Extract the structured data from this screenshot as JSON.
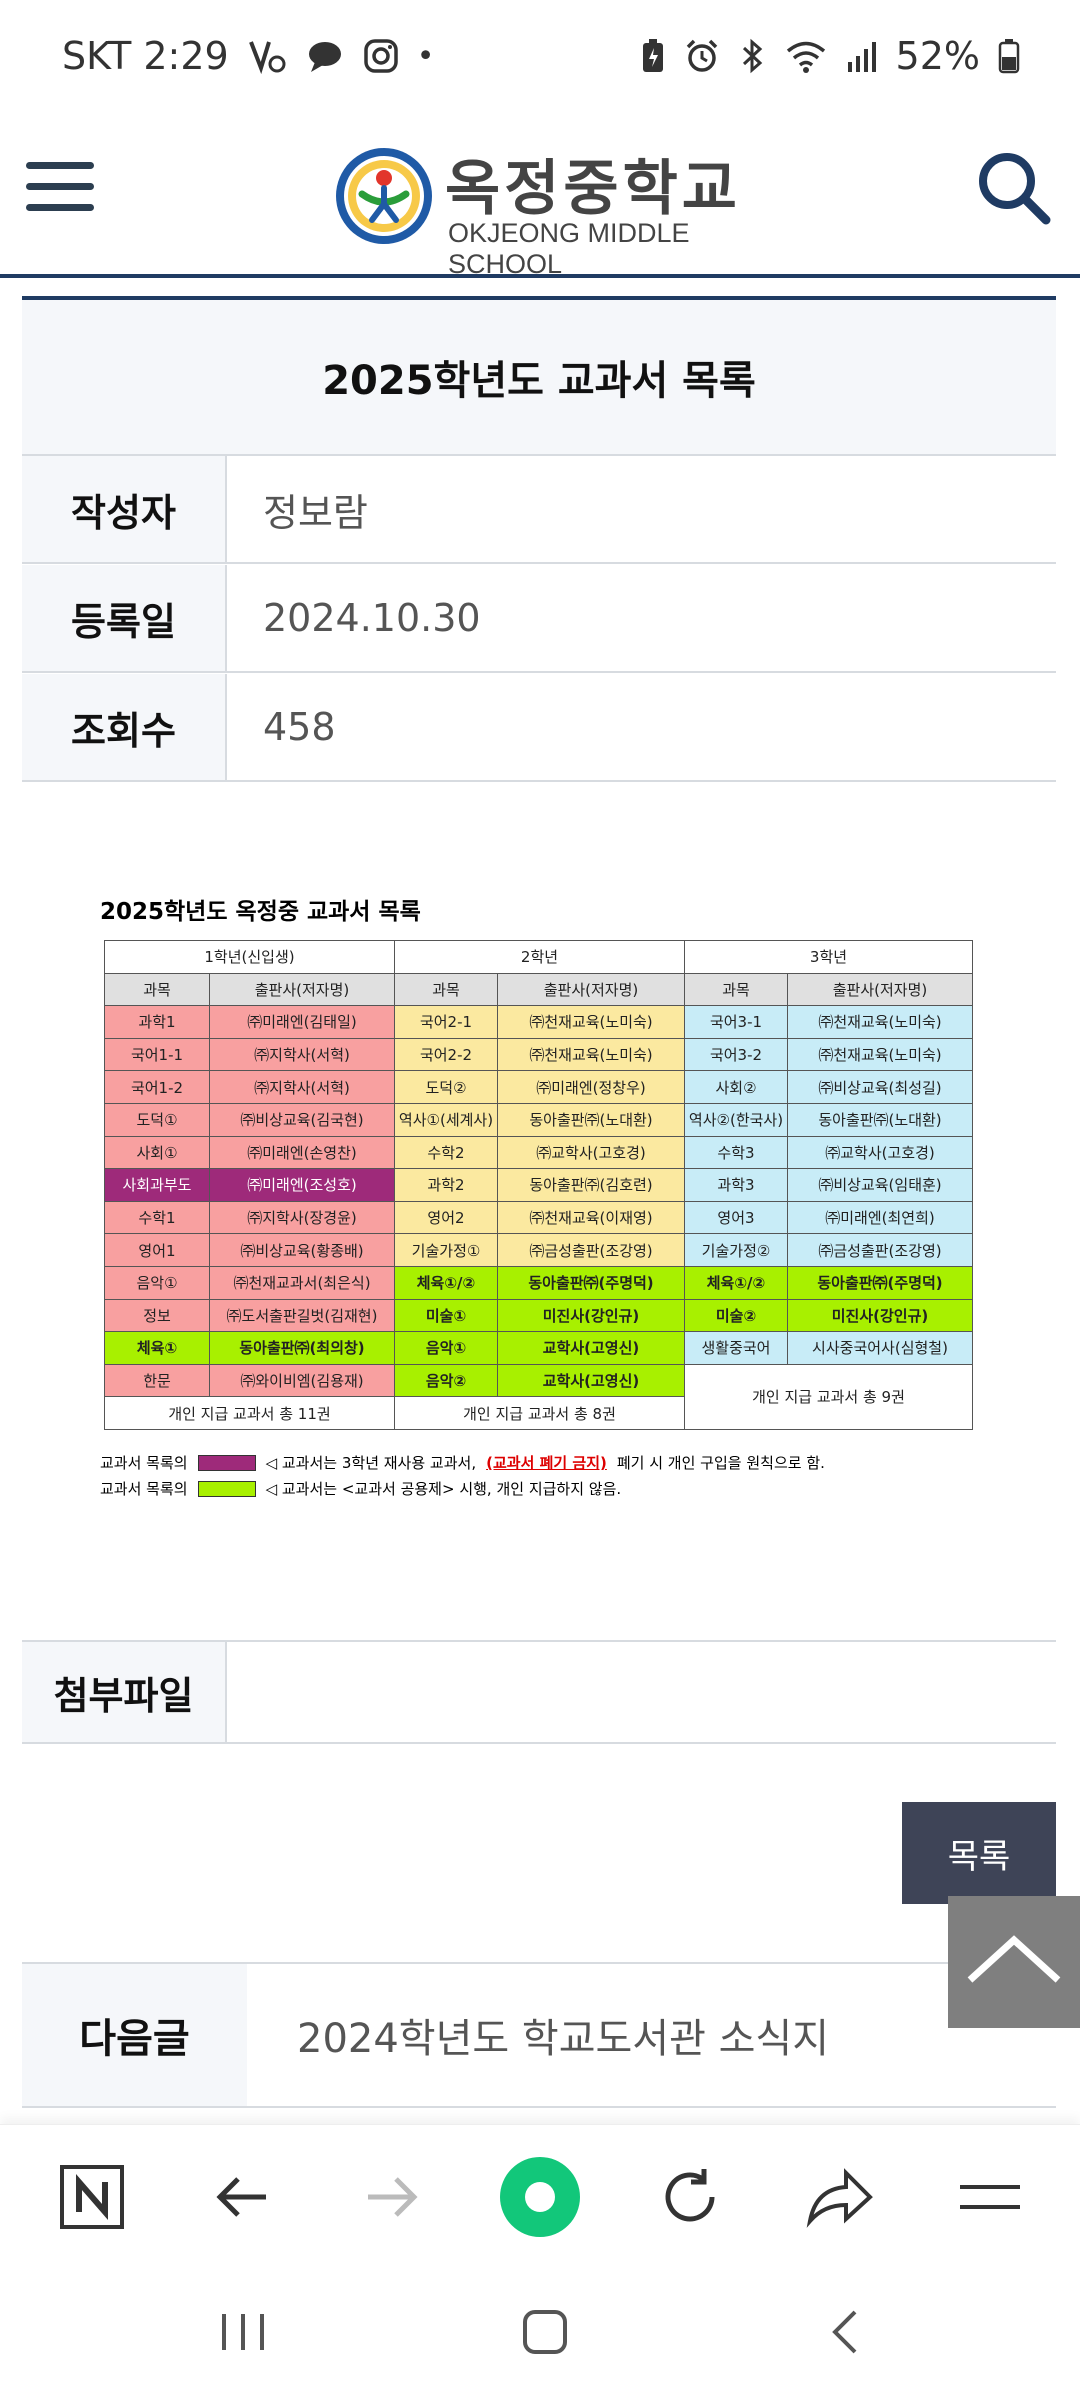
{
  "status": {
    "carrier_time": "SKT 2:29",
    "battery": "52%",
    "icons": [
      "volte-icon",
      "chat-icon",
      "instagram-icon",
      "dot-icon",
      "battery-saver-icon",
      "alarm-icon",
      "bluetooth-icon",
      "wifi-icon",
      "signal-icon",
      "battery-icon"
    ]
  },
  "header": {
    "logo_title": "옥정중학교",
    "logo_subtitle": "OKJEONG MIDDLE SCHOOL",
    "menu_icon": "hamburger-menu-icon",
    "search_icon": "search-icon"
  },
  "post": {
    "title": "2025학년도 교과서 목록",
    "meta": [
      {
        "label": "작성자",
        "value": "정보람"
      },
      {
        "label": "등록일",
        "value": "2024.10.30"
      },
      {
        "label": "조회수",
        "value": "458"
      }
    ],
    "attachment_label": "첨부파일",
    "list_button": "목록",
    "next_label": "다음글",
    "next_title": "2024학년도 학교도서관 소식지"
  },
  "doc": {
    "title": "2025학년도 옥정중 교과서 목록",
    "grades": [
      "1학년(신입생)",
      "2학년",
      "3학년"
    ],
    "col_subject": "과목",
    "col_publisher": "출판사(저자명)",
    "g1": [
      {
        "s": "과학1",
        "p": "㈜미래엔(김태일)",
        "c": "pk"
      },
      {
        "s": "국어1-1",
        "p": "㈜지학사(서혁)",
        "c": "pk"
      },
      {
        "s": "국어1-2",
        "p": "㈜지학사(서혁)",
        "c": "pk"
      },
      {
        "s": "도덕①",
        "p": "㈜비상교육(김국현)",
        "c": "pk"
      },
      {
        "s": "사회①",
        "p": "㈜미래엔(손영찬)",
        "c": "pk"
      },
      {
        "s": "사회과부도",
        "p": "㈜미래엔(조성호)",
        "c": "pu"
      },
      {
        "s": "수학1",
        "p": "㈜지학사(장경윤)",
        "c": "pk"
      },
      {
        "s": "영어1",
        "p": "㈜비상교육(황종배)",
        "c": "pk"
      },
      {
        "s": "음악①",
        "p": "㈜천재교과서(최은식)",
        "c": "pk"
      },
      {
        "s": "정보",
        "p": "㈜도서출판길벗(김재현)",
        "c": "pk"
      },
      {
        "s": "체육①",
        "p": "동아출판㈜(최의창)",
        "c": "gr"
      },
      {
        "s": "한문",
        "p": "㈜와이비엠(김용재)",
        "c": "pk"
      }
    ],
    "g2": [
      {
        "s": "국어2-1",
        "p": "㈜천재교육(노미숙)",
        "c": "ye"
      },
      {
        "s": "국어2-2",
        "p": "㈜천재교육(노미숙)",
        "c": "ye"
      },
      {
        "s": "도덕②",
        "p": "㈜미래엔(정창우)",
        "c": "ye"
      },
      {
        "s": "역사①(세계사)",
        "p": "동아출판㈜(노대환)",
        "c": "ye"
      },
      {
        "s": "수학2",
        "p": "㈜교학사(고호경)",
        "c": "ye"
      },
      {
        "s": "과학2",
        "p": "동아출판㈜(김호련)",
        "c": "ye"
      },
      {
        "s": "영어2",
        "p": "㈜천재교육(이재영)",
        "c": "ye"
      },
      {
        "s": "기술가정①",
        "p": "㈜금성출판(조강영)",
        "c": "ye"
      },
      {
        "s": "체육①/②",
        "p": "동아출판㈜(주명덕)",
        "c": "gr"
      },
      {
        "s": "미술①",
        "p": "미진사(강인규)",
        "c": "gr"
      },
      {
        "s": "음악①",
        "p": "교학사(고영신)",
        "c": "gr"
      },
      {
        "s": "음악②",
        "p": "교학사(고영신)",
        "c": "gr"
      }
    ],
    "g3": [
      {
        "s": "국어3-1",
        "p": "㈜천재교육(노미숙)",
        "c": "bl"
      },
      {
        "s": "국어3-2",
        "p": "㈜천재교육(노미숙)",
        "c": "bl"
      },
      {
        "s": "사회②",
        "p": "㈜비상교육(최성길)",
        "c": "bl"
      },
      {
        "s": "역사②(한국사)",
        "p": "동아출판㈜(노대환)",
        "c": "bl"
      },
      {
        "s": "수학3",
        "p": "㈜교학사(고호경)",
        "c": "bl"
      },
      {
        "s": "과학3",
        "p": "㈜비상교육(임태훈)",
        "c": "bl"
      },
      {
        "s": "영어3",
        "p": "㈜미래엔(최연희)",
        "c": "bl"
      },
      {
        "s": "기술가정②",
        "p": "㈜금성출판(조강영)",
        "c": "bl"
      },
      {
        "s": "체육①/②",
        "p": "동아출판㈜(주명덕)",
        "c": "gr"
      },
      {
        "s": "미술②",
        "p": "미진사(강인규)",
        "c": "gr"
      },
      {
        "s": "생활중국어",
        "p": "시사중국어사(심형철)",
        "c": "bl"
      }
    ],
    "total_g1": "개인 지급 교과서 총 11권",
    "total_g2": "개인 지급 교과서 총 8권",
    "total_g3": "개인 지급 교과서 총 9권",
    "legend1_prefix": "교과서 목록의",
    "legend1_text_a": "◁ 교과서는 3학년 재사용 교과서,",
    "legend1_warn": "(교과서 폐기 금지)",
    "legend1_text_b": "폐기 시 개인 구입을 원칙으로 함.",
    "legend2_prefix": "교과서 목록의",
    "legend2_text": "◁ 교과서는 <교과서 공용제> 시행, 개인 지급하지 않음.",
    "colors": {
      "pink": "#f8a0a0",
      "yellow": "#fbe9a0",
      "blue": "#c8ecf7",
      "purple": "#9e2a7a",
      "green": "#a8f000"
    }
  },
  "browser": {
    "items": [
      "naver-home-icon",
      "back-arrow-icon",
      "forward-arrow-icon",
      "green-dot-icon",
      "refresh-icon",
      "share-icon",
      "menu-icon"
    ]
  },
  "navbar": {
    "items": [
      "recent-apps-icon",
      "home-icon",
      "back-icon"
    ]
  }
}
